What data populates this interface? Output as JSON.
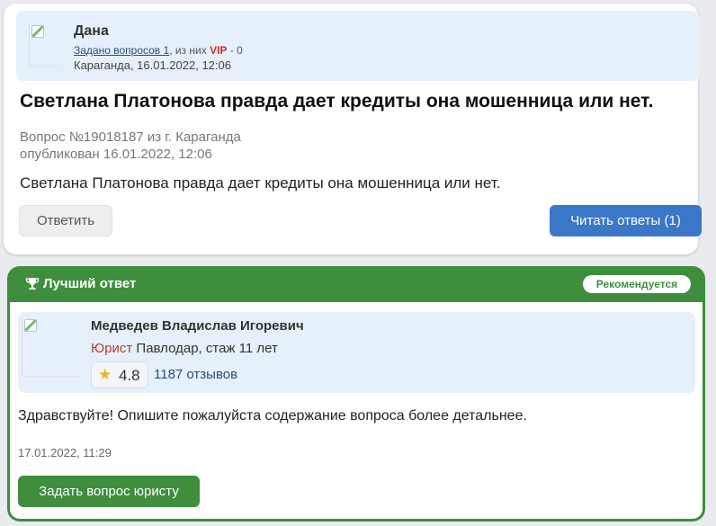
{
  "question_card": {
    "author": {
      "name": "Дана",
      "questions_asked_link": "Задано вопросов 1",
      "of_which": ", из них ",
      "vip_label": "VIP",
      "vip_count": " - 0",
      "location_date": "Караганда, 16.01.2022, 12:06"
    },
    "title": "Светлана Платонова правда дает кредиты она мошенница или нет.",
    "number_line": "Вопрос №19018187 из г. Караганда",
    "published_line": "опубликован 16.01.2022, 12:06",
    "body": "Светлана Платонова правда дает кредиты она мошенница или нет.",
    "answer_button": "Ответить",
    "read_answers_button": "Читать ответы (1)"
  },
  "best_answer": {
    "header_title": "Лучший ответ",
    "recommended_badge": "Рекомендуется",
    "lawyer": {
      "name": "Медведев Владислав Игоревич",
      "role": "Юрист",
      "details": " Павлодар, стаж 11 лет",
      "rating": "4.8",
      "reviews": "1187 отзывов"
    },
    "text": "Здравствуйте! Опишите пожалуйста содержание вопроса более детальнее.",
    "date": "17.01.2022, 11:29",
    "ask_button": "Задать вопрос юристу"
  },
  "colors": {
    "accent_blue": "#3b77c8",
    "accent_green": "#3e8e3e",
    "vip_red": "#d12a2a"
  }
}
